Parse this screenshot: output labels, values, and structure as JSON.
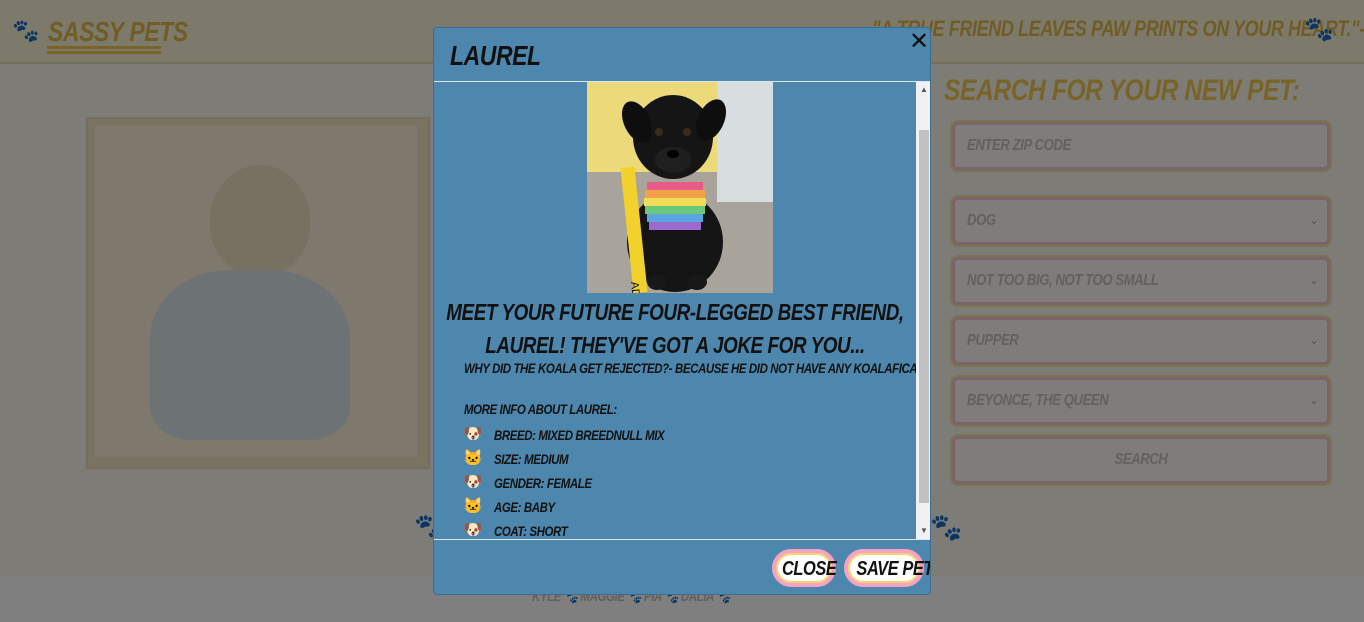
{
  "app": {
    "brand": "Sassy Pets",
    "quote": "\"A true friend leaves paw prints on your heart.\"-"
  },
  "search": {
    "title": "Search for your new pet:",
    "zip_placeholder": "Enter zip code",
    "type_value": "Dog",
    "size_value": "Not too big, not too small",
    "age_value": "Pupper",
    "gender_value": "Beyonce, the queen",
    "search_label": "Search"
  },
  "footer": {
    "names": "Kyle 🐾  Maggie 🐾  Pia 🐾  Dalia 🐾"
  },
  "modal": {
    "title": "Laurel",
    "close_icon": "close-icon",
    "headline": "Meet your future four-legged best friend, Laurel! They've got a joke for you...",
    "joke": "Why did the koala get rejected?- Because he did not have any koalafication.",
    "more_label": "More info about Laurel:",
    "info": [
      {
        "icon": "dog-icon",
        "text": "Breed: Mixed Breednull mix"
      },
      {
        "icon": "cat-icon",
        "text": "Size: Medium"
      },
      {
        "icon": "dog-icon",
        "text": "Gender: Female"
      },
      {
        "icon": "cat-icon",
        "text": "Age: Baby"
      },
      {
        "icon": "dog-icon",
        "text": "Coat: Short"
      }
    ],
    "close_label": "Close",
    "save_label": "Save Pet"
  },
  "colors": {
    "modal_bg": "#4e87ad",
    "accent_yellow": "#f0c850",
    "accent_pink": "#f6a2c2"
  }
}
